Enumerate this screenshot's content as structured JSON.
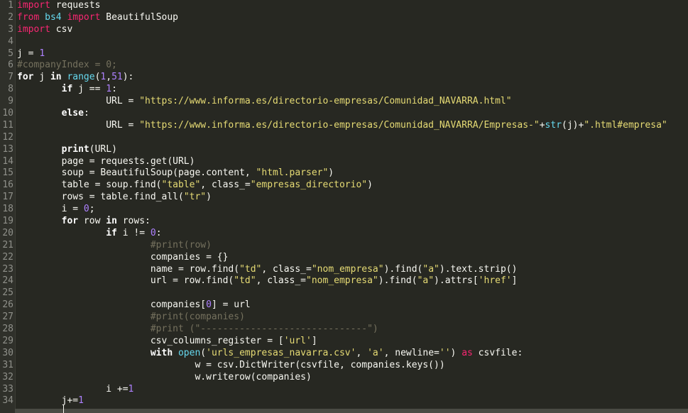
{
  "editor": {
    "lines": [
      {
        "n": "1",
        "tokens": [
          {
            "t": "import",
            "c": "kw"
          },
          {
            "t": " requests",
            "c": "plain"
          }
        ]
      },
      {
        "n": "2",
        "tokens": [
          {
            "t": "from",
            "c": "kw"
          },
          {
            "t": " ",
            "c": "plain"
          },
          {
            "t": "bs4",
            "c": "bi"
          },
          {
            "t": " ",
            "c": "plain"
          },
          {
            "t": "import",
            "c": "kw"
          },
          {
            "t": " BeautifulSoup",
            "c": "plain"
          }
        ]
      },
      {
        "n": "3",
        "tokens": [
          {
            "t": "import",
            "c": "kw"
          },
          {
            "t": " csv",
            "c": "plain"
          }
        ]
      },
      {
        "n": "4",
        "tokens": []
      },
      {
        "n": "5",
        "tokens": [
          {
            "t": "j = ",
            "c": "plain"
          },
          {
            "t": "1",
            "c": "num"
          }
        ]
      },
      {
        "n": "6",
        "tokens": [
          {
            "t": "#companyIndex = 0;",
            "c": "com"
          }
        ]
      },
      {
        "n": "7",
        "tokens": [
          {
            "t": "for",
            "c": "kwb"
          },
          {
            "t": " j ",
            "c": "plain"
          },
          {
            "t": "in",
            "c": "kwb"
          },
          {
            "t": " ",
            "c": "plain"
          },
          {
            "t": "range",
            "c": "bi"
          },
          {
            "t": "(",
            "c": "plain"
          },
          {
            "t": "1",
            "c": "num"
          },
          {
            "t": ",",
            "c": "plain"
          },
          {
            "t": "51",
            "c": "num"
          },
          {
            "t": "):",
            "c": "plain"
          }
        ]
      },
      {
        "n": "8",
        "tokens": [
          {
            "t": "        ",
            "c": "plain"
          },
          {
            "t": "if",
            "c": "kwb"
          },
          {
            "t": " j == ",
            "c": "plain"
          },
          {
            "t": "1",
            "c": "num"
          },
          {
            "t": ":",
            "c": "plain"
          }
        ]
      },
      {
        "n": "9",
        "tokens": [
          {
            "t": "                URL = ",
            "c": "plain"
          },
          {
            "t": "\"https://www.informa.es/directorio-empresas/Comunidad_NAVARRA.html\"",
            "c": "str"
          }
        ]
      },
      {
        "n": "10",
        "tokens": [
          {
            "t": "        ",
            "c": "plain"
          },
          {
            "t": "else",
            "c": "kwb"
          },
          {
            "t": ":",
            "c": "plain"
          }
        ]
      },
      {
        "n": "11",
        "tokens": [
          {
            "t": "                URL = ",
            "c": "plain"
          },
          {
            "t": "\"https://www.informa.es/directorio-empresas/Comunidad_NAVARRA/Empresas-\"",
            "c": "str"
          },
          {
            "t": "+",
            "c": "plain"
          },
          {
            "t": "str",
            "c": "bi"
          },
          {
            "t": "(j)+",
            "c": "plain"
          },
          {
            "t": "\".html#empresa\"",
            "c": "str"
          }
        ]
      },
      {
        "n": "12",
        "tokens": []
      },
      {
        "n": "13",
        "tokens": [
          {
            "t": "        ",
            "c": "plain"
          },
          {
            "t": "print",
            "c": "kwb"
          },
          {
            "t": "(URL)",
            "c": "plain"
          }
        ]
      },
      {
        "n": "14",
        "tokens": [
          {
            "t": "        page = requests.get(URL)",
            "c": "plain"
          }
        ]
      },
      {
        "n": "15",
        "tokens": [
          {
            "t": "        soup = BeautifulSoup(page.content, ",
            "c": "plain"
          },
          {
            "t": "\"html.parser\"",
            "c": "str"
          },
          {
            "t": ")",
            "c": "plain"
          }
        ]
      },
      {
        "n": "16",
        "tokens": [
          {
            "t": "        table = soup.find(",
            "c": "plain"
          },
          {
            "t": "\"table\"",
            "c": "str"
          },
          {
            "t": ", class_=",
            "c": "plain"
          },
          {
            "t": "\"empresas_directorio\"",
            "c": "str"
          },
          {
            "t": ")",
            "c": "plain"
          }
        ]
      },
      {
        "n": "17",
        "tokens": [
          {
            "t": "        rows = table.find_all(",
            "c": "plain"
          },
          {
            "t": "\"tr\"",
            "c": "str"
          },
          {
            "t": ")",
            "c": "plain"
          }
        ]
      },
      {
        "n": "18",
        "tokens": [
          {
            "t": "        i = ",
            "c": "plain"
          },
          {
            "t": "0",
            "c": "num"
          },
          {
            "t": ";",
            "c": "plain"
          }
        ]
      },
      {
        "n": "19",
        "tokens": [
          {
            "t": "        ",
            "c": "plain"
          },
          {
            "t": "for",
            "c": "kwb"
          },
          {
            "t": " row ",
            "c": "plain"
          },
          {
            "t": "in",
            "c": "kwb"
          },
          {
            "t": " rows:",
            "c": "plain"
          }
        ]
      },
      {
        "n": "20",
        "tokens": [
          {
            "t": "                ",
            "c": "plain"
          },
          {
            "t": "if",
            "c": "kwb"
          },
          {
            "t": " i != ",
            "c": "plain"
          },
          {
            "t": "0",
            "c": "num"
          },
          {
            "t": ":",
            "c": "plain"
          }
        ]
      },
      {
        "n": "21",
        "tokens": [
          {
            "t": "                        ",
            "c": "plain"
          },
          {
            "t": "#print(row)",
            "c": "com"
          }
        ]
      },
      {
        "n": "22",
        "tokens": [
          {
            "t": "                        companies = {}",
            "c": "plain"
          }
        ]
      },
      {
        "n": "23",
        "tokens": [
          {
            "t": "                        name = row.find(",
            "c": "plain"
          },
          {
            "t": "\"td\"",
            "c": "str"
          },
          {
            "t": ", class_=",
            "c": "plain"
          },
          {
            "t": "\"nom_empresa\"",
            "c": "str"
          },
          {
            "t": ").find(",
            "c": "plain"
          },
          {
            "t": "\"a\"",
            "c": "str"
          },
          {
            "t": ").text.strip()",
            "c": "plain"
          }
        ]
      },
      {
        "n": "24",
        "tokens": [
          {
            "t": "                        url = row.find(",
            "c": "plain"
          },
          {
            "t": "\"td\"",
            "c": "str"
          },
          {
            "t": ", class_=",
            "c": "plain"
          },
          {
            "t": "\"nom_empresa\"",
            "c": "str"
          },
          {
            "t": ").find(",
            "c": "plain"
          },
          {
            "t": "\"a\"",
            "c": "str"
          },
          {
            "t": ").attrs[",
            "c": "plain"
          },
          {
            "t": "'href'",
            "c": "str"
          },
          {
            "t": "]",
            "c": "plain"
          }
        ]
      },
      {
        "n": "25",
        "tokens": []
      },
      {
        "n": "26",
        "tokens": [
          {
            "t": "                        companies[",
            "c": "plain"
          },
          {
            "t": "0",
            "c": "num"
          },
          {
            "t": "] = url",
            "c": "plain"
          }
        ]
      },
      {
        "n": "27",
        "tokens": [
          {
            "t": "                        ",
            "c": "plain"
          },
          {
            "t": "#print(companies)",
            "c": "com"
          }
        ]
      },
      {
        "n": "28",
        "tokens": [
          {
            "t": "                        ",
            "c": "plain"
          },
          {
            "t": "#print (\"------------------------------\")",
            "c": "com"
          }
        ]
      },
      {
        "n": "29",
        "tokens": [
          {
            "t": "                        csv_columns_register = [",
            "c": "plain"
          },
          {
            "t": "'url'",
            "c": "str"
          },
          {
            "t": "]",
            "c": "plain"
          }
        ]
      },
      {
        "n": "30",
        "tokens": [
          {
            "t": "                        ",
            "c": "plain"
          },
          {
            "t": "with",
            "c": "kwb"
          },
          {
            "t": " ",
            "c": "plain"
          },
          {
            "t": "open",
            "c": "bi"
          },
          {
            "t": "(",
            "c": "plain"
          },
          {
            "t": "'urls_empresas_navarra.csv'",
            "c": "str"
          },
          {
            "t": ", ",
            "c": "plain"
          },
          {
            "t": "'a'",
            "c": "str"
          },
          {
            "t": ", newline=",
            "c": "plain"
          },
          {
            "t": "''",
            "c": "str"
          },
          {
            "t": ") ",
            "c": "plain"
          },
          {
            "t": "as",
            "c": "kw"
          },
          {
            "t": " csvfile:",
            "c": "plain"
          }
        ]
      },
      {
        "n": "31",
        "tokens": [
          {
            "t": "                                w = csv.DictWriter(csvfile, companies.keys())",
            "c": "plain"
          }
        ]
      },
      {
        "n": "32",
        "tokens": [
          {
            "t": "                                w.writerow(companies)",
            "c": "plain"
          }
        ]
      },
      {
        "n": "33",
        "tokens": [
          {
            "t": "                i +=",
            "c": "plain"
          },
          {
            "t": "1",
            "c": "num"
          }
        ]
      },
      {
        "n": "34",
        "tokens": [
          {
            "t": "        j+=",
            "c": "plain"
          },
          {
            "t": "1",
            "c": "num"
          }
        ]
      }
    ]
  }
}
